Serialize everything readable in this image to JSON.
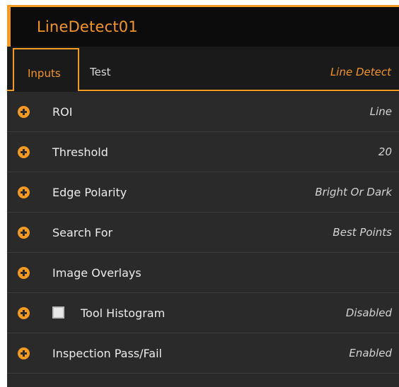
{
  "title": "LineDetect01",
  "tabs": {
    "inputs_label": "Inputs",
    "test_label": "Test",
    "right_label": "Line Detect"
  },
  "rows": [
    {
      "label": "ROI",
      "value": "Line"
    },
    {
      "label": "Threshold",
      "value": "20"
    },
    {
      "label": "Edge Polarity",
      "value": "Bright Or Dark"
    },
    {
      "label": "Search For",
      "value": "Best Points"
    },
    {
      "label": "Image Overlays",
      "value": ""
    },
    {
      "label": "Tool Histogram",
      "value": "Disabled",
      "checked": false
    },
    {
      "label": "Inspection Pass/Fail",
      "value": "Enabled"
    }
  ],
  "colors": {
    "accent": "#f29a22",
    "panel_bg": "#2a2a2a",
    "title_bg": "#0c0c0c"
  }
}
